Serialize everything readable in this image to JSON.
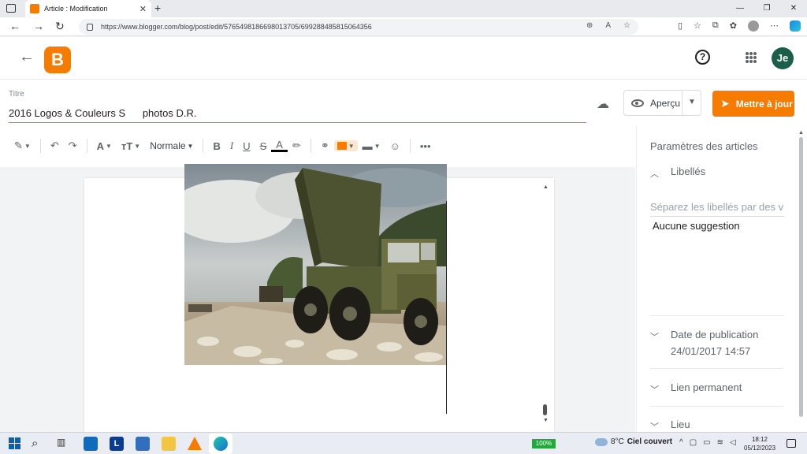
{
  "browser": {
    "tab_title": "Article : Modification",
    "url": "https://www.blogger.com/blog/post/edit/5765498186698013705/699288485815064356"
  },
  "blogger": {
    "user_initials": "Je",
    "title_label": "Titre",
    "title_value": "2016 Logos & Couleurs S      photos D.R.",
    "preview_label": "Aperçu",
    "update_label": "Mettre à jour"
  },
  "toolbar": {
    "format": "Normale"
  },
  "sidebar": {
    "heading": "Paramètres des articles",
    "labels_section": "Libellés",
    "labels_placeholder": "Séparez les libellés par des virgules",
    "no_suggestion": "Aucune suggestion",
    "pub_date_section": "Date de publication",
    "pub_date_value": "24/01/2017 14:57",
    "permalink_section": "Lien permanent",
    "location_section": "Lieu"
  },
  "taskbar": {
    "battery": "100%",
    "temperature": "8°C",
    "weather": "Ciel couvert",
    "time": "18:12",
    "date": "05/12/2023"
  },
  "colors": {
    "accent": "#f57c00",
    "avatar": "#1b5e4a"
  }
}
